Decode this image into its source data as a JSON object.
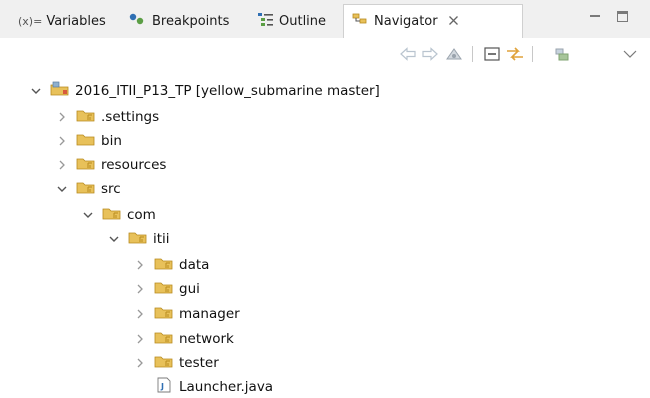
{
  "tabs": [
    {
      "name": "tab-variables",
      "icon_text": "(x)=",
      "label": "Variables"
    },
    {
      "name": "tab-breakpoints",
      "label": "Breakpoints"
    },
    {
      "name": "tab-outline",
      "label": "Outline"
    },
    {
      "name": "tab-navigator",
      "label": "Navigator",
      "active": true
    }
  ],
  "colors": {
    "folder_yellow": "#e8c15a",
    "folder_dark": "#b88a1e",
    "chevron": "#7a7a7a",
    "toolbar_green": "#a7c59a",
    "toolbar_gray": "#9aa3ad"
  },
  "icons": [
    "back-icon",
    "forward-icon",
    "home-icon",
    "collapse-all-icon",
    "link-with-editor-icon",
    "view-menu-settings-icon",
    "view-menu-icon",
    "minimize-icon",
    "maximize-icon"
  ],
  "tree": [
    {
      "label": "2016_ITII_P13_TP [yellow_submarine master]",
      "depth": 0,
      "expanded": true,
      "kind": "project"
    },
    {
      "label": ".settings",
      "depth": 1,
      "expanded": false,
      "kind": "folder-git"
    },
    {
      "label": "bin",
      "depth": 1,
      "expanded": false,
      "kind": "folder"
    },
    {
      "label": "resources",
      "depth": 1,
      "expanded": false,
      "kind": "folder-git"
    },
    {
      "label": "src",
      "depth": 1,
      "expanded": true,
      "kind": "folder-git"
    },
    {
      "label": "com",
      "depth": 2,
      "expanded": true,
      "kind": "folder-git"
    },
    {
      "label": "itii",
      "depth": 3,
      "expanded": true,
      "kind": "folder-git"
    },
    {
      "label": "data",
      "depth": 4,
      "expanded": false,
      "kind": "folder-git"
    },
    {
      "label": "gui",
      "depth": 4,
      "expanded": false,
      "kind": "folder-git"
    },
    {
      "label": "manager",
      "depth": 4,
      "expanded": false,
      "kind": "folder-git"
    },
    {
      "label": "network",
      "depth": 4,
      "expanded": false,
      "kind": "folder-git"
    },
    {
      "label": "tester",
      "depth": 4,
      "expanded": false,
      "kind": "folder-git"
    },
    {
      "label": "Launcher.java",
      "depth": 4,
      "expanded": null,
      "kind": "java-file"
    }
  ]
}
